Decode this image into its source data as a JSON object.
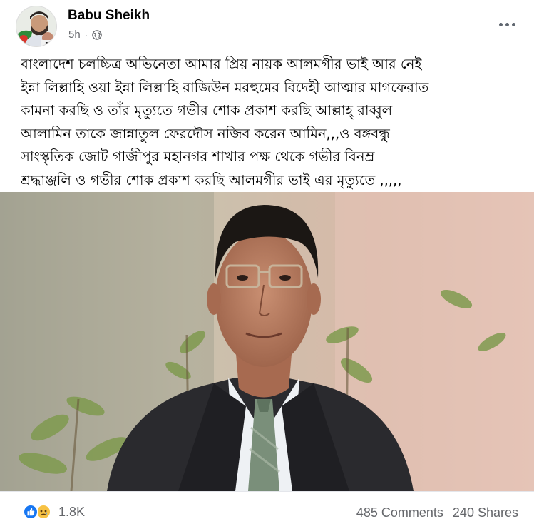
{
  "post": {
    "author": "Babu Sheikh",
    "timestamp": "5h",
    "privacy_icon": "globe-icon",
    "avatar_badge": "150",
    "caption_lines": [
      "বাংলাদেশ চলচ্চিত্র অভিনেতা আমার প্রিয় নায়ক আলমগীর ভাই আর নেই",
      "ইন্না লিল্লাহি ওয়া ইন্না লিল্লাহি রাজিউন মরহুমের বিদেহী আত্মার মাগফেরাত",
      "কামনা করছি ও তাঁর মৃত্যুতে গভীর শোক প্রকাশ করছি আল্লাহ্ রাব্বুল",
      "আলামিন তাকে জান্নাতুল ফেরদৌস নজিব করেন আমিন,,,ও বঙ্গবন্ধু",
      "সাংস্কৃতিক জোট গাজীপুর মহানগর শাখার পক্ষ থেকে গভীর বিনম্র",
      "শ্রদ্ধাঞ্জলি ও গভীর শোক প্রকাশ করছি আলমগীর ভাই এর মৃত্যুতে ,,,,,"
    ]
  },
  "footer": {
    "reaction_count": "1.8K",
    "comments": "485 Comments",
    "shares": "240 Shares"
  },
  "colors": {
    "facebook_blue": "#1877f2",
    "muted_text": "#65676b",
    "sad_yellow": "#f7c244"
  }
}
